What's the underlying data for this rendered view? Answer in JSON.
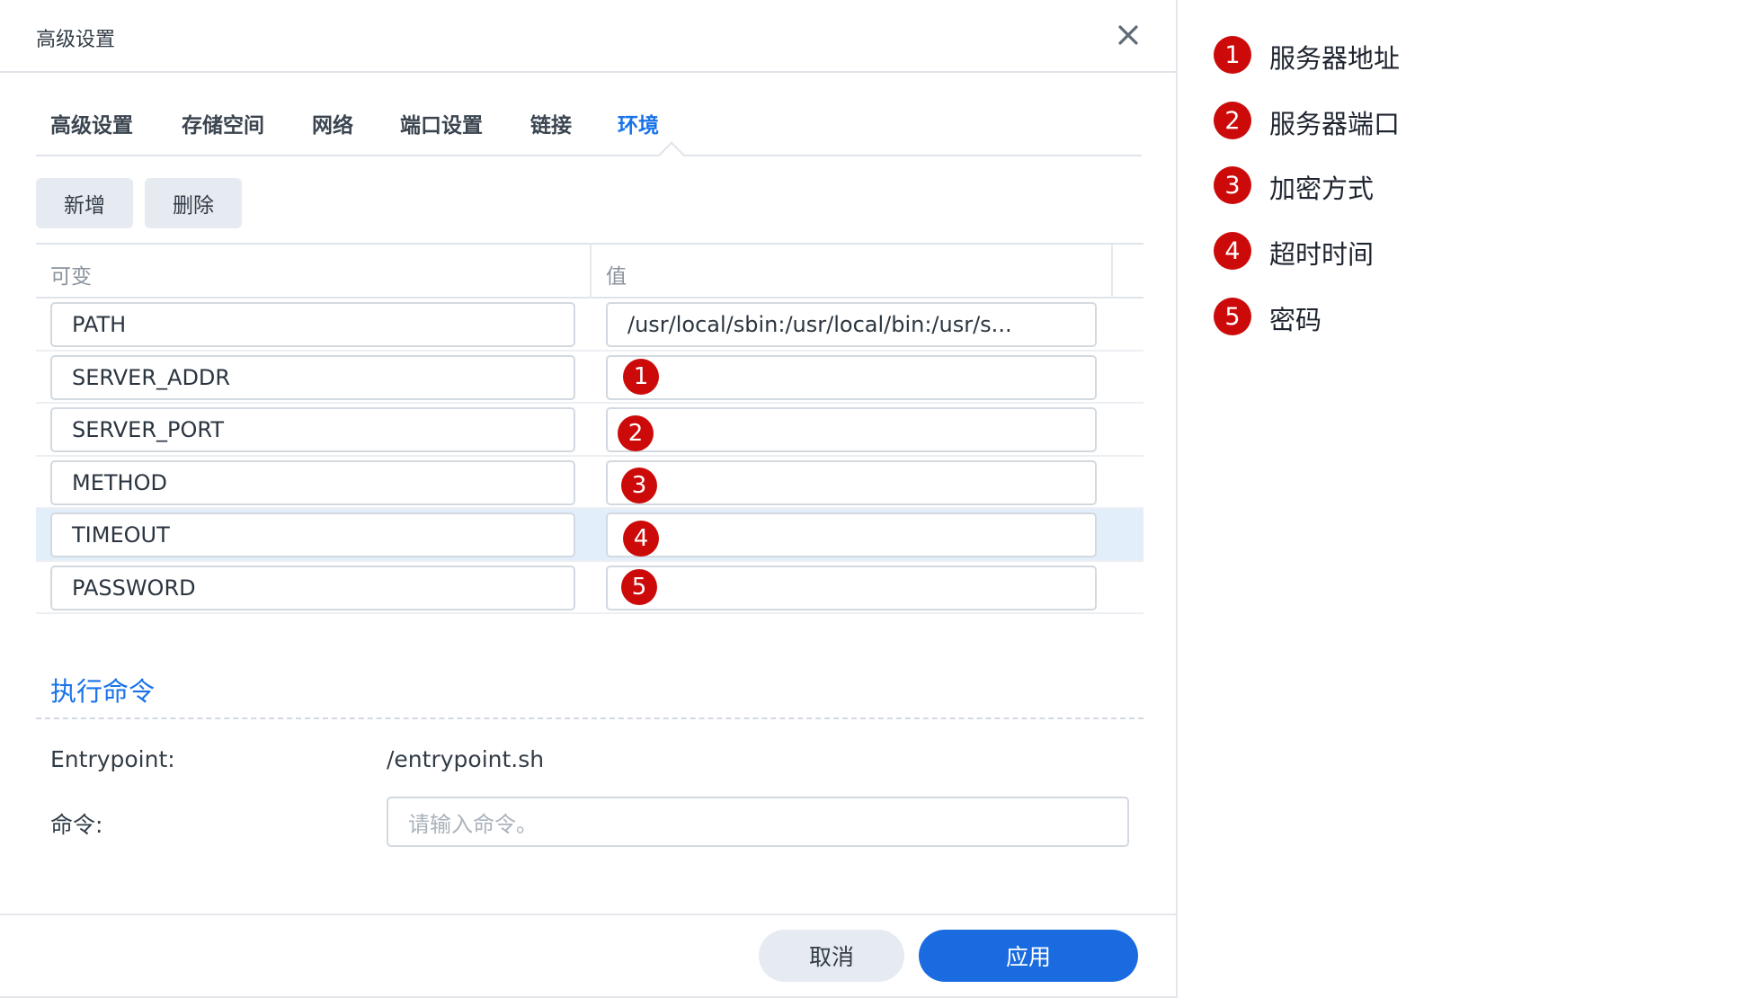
{
  "dialog": {
    "title": "高级设置",
    "close_icon": "close-icon"
  },
  "tabs": [
    {
      "label": "高级设置"
    },
    {
      "label": "存储空间"
    },
    {
      "label": "网络"
    },
    {
      "label": "端口设置"
    },
    {
      "label": "链接"
    },
    {
      "label": "环境",
      "active": true
    }
  ],
  "toolbar": {
    "add_label": "新增",
    "delete_label": "删除"
  },
  "env_table": {
    "headers": [
      "可变",
      "值"
    ],
    "rows": [
      {
        "key": "PATH",
        "value": "/usr/local/sbin:/usr/local/bin:/usr/s..."
      },
      {
        "key": "SERVER_ADDR",
        "value": "",
        "marker": "1"
      },
      {
        "key": "SERVER_PORT",
        "value": "",
        "marker": "2"
      },
      {
        "key": "METHOD",
        "value": "",
        "marker": "3"
      },
      {
        "key": "TIMEOUT",
        "value": "",
        "marker": "4",
        "selected": true
      },
      {
        "key": "PASSWORD",
        "value": "",
        "marker": "5"
      }
    ]
  },
  "command": {
    "section_title": "执行命令",
    "entrypoint_label": "Entrypoint:",
    "entrypoint_value": "/entrypoint.sh",
    "command_label": "命令:",
    "command_placeholder": "请输入命令。"
  },
  "footer": {
    "cancel_label": "取消",
    "apply_label": "应用"
  },
  "legend": [
    {
      "num": "1",
      "text": "服务器地址"
    },
    {
      "num": "2",
      "text": "服务器端口"
    },
    {
      "num": "3",
      "text": "加密方式"
    },
    {
      "num": "4",
      "text": "超时时间"
    },
    {
      "num": "5",
      "text": "密码"
    }
  ],
  "colors": {
    "accent": "#1a73e8",
    "marker": "#cc0a0a",
    "selected_row": "#e3eefb"
  }
}
